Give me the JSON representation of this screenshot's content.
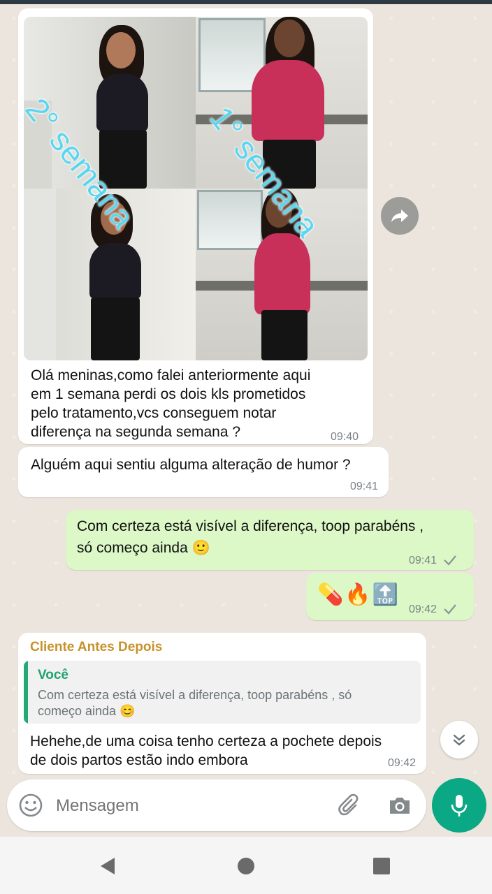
{
  "colors": {
    "incoming_bubble": "#ffffff",
    "outgoing_bubble": "#dcf8c6",
    "sender_name": "#c7922b",
    "quote_author": "#1fa36e",
    "accent": "#0aa884"
  },
  "messages": [
    {
      "type": "image_with_caption",
      "direction": "incoming",
      "image_labels": [
        "2° semana",
        "1° semana"
      ],
      "text": "Olá meninas,como falei anteriormente aqui em 1 semana perdi os dois kls prometidos pelo tratamento,vcs conseguem notar diferença na segunda semana ?",
      "lines": [
        "Olá meninas,como falei anteriormente aqui",
        "em 1 semana perdi os dois kls prometidos",
        "pelo tratamento,vcs conseguem notar",
        "diferença na segunda semana ?"
      ],
      "time": "09:40"
    },
    {
      "type": "text",
      "direction": "incoming",
      "text": "Alguém aqui sentiu alguma alteração de humor ?",
      "time": "09:41"
    },
    {
      "type": "text",
      "direction": "outgoing",
      "lines": [
        "Com certeza está visível a diferença, toop parabéns ,",
        "só começo ainda 🙂"
      ],
      "time": "09:41",
      "status": "sent"
    },
    {
      "type": "emoji",
      "direction": "outgoing",
      "emoji": "💊🔥🔝",
      "time": "09:42",
      "status": "sent"
    },
    {
      "type": "reply",
      "direction": "incoming",
      "sender": "Cliente Antes Depois",
      "quoted_author": "Você",
      "quoted_lines": [
        "Com certeza está visível a diferença, toop parabéns , só",
        "começo ainda 😊"
      ],
      "lines": [
        "Hehehe,de uma coisa tenho certeza a pochete depois",
        "de dois partos estão indo embora"
      ],
      "time": "09:42"
    }
  ],
  "composer": {
    "placeholder": "Mensagem"
  },
  "icons": {
    "forward": "forward-icon",
    "scroll_down": "double-chevron-down-icon",
    "emoji": "emoji-icon",
    "attach": "paperclip-icon",
    "camera": "camera-icon",
    "mic": "mic-icon",
    "nav_back": "back-triangle-icon",
    "nav_home": "home-circle-icon",
    "nav_recents": "recents-square-icon"
  }
}
